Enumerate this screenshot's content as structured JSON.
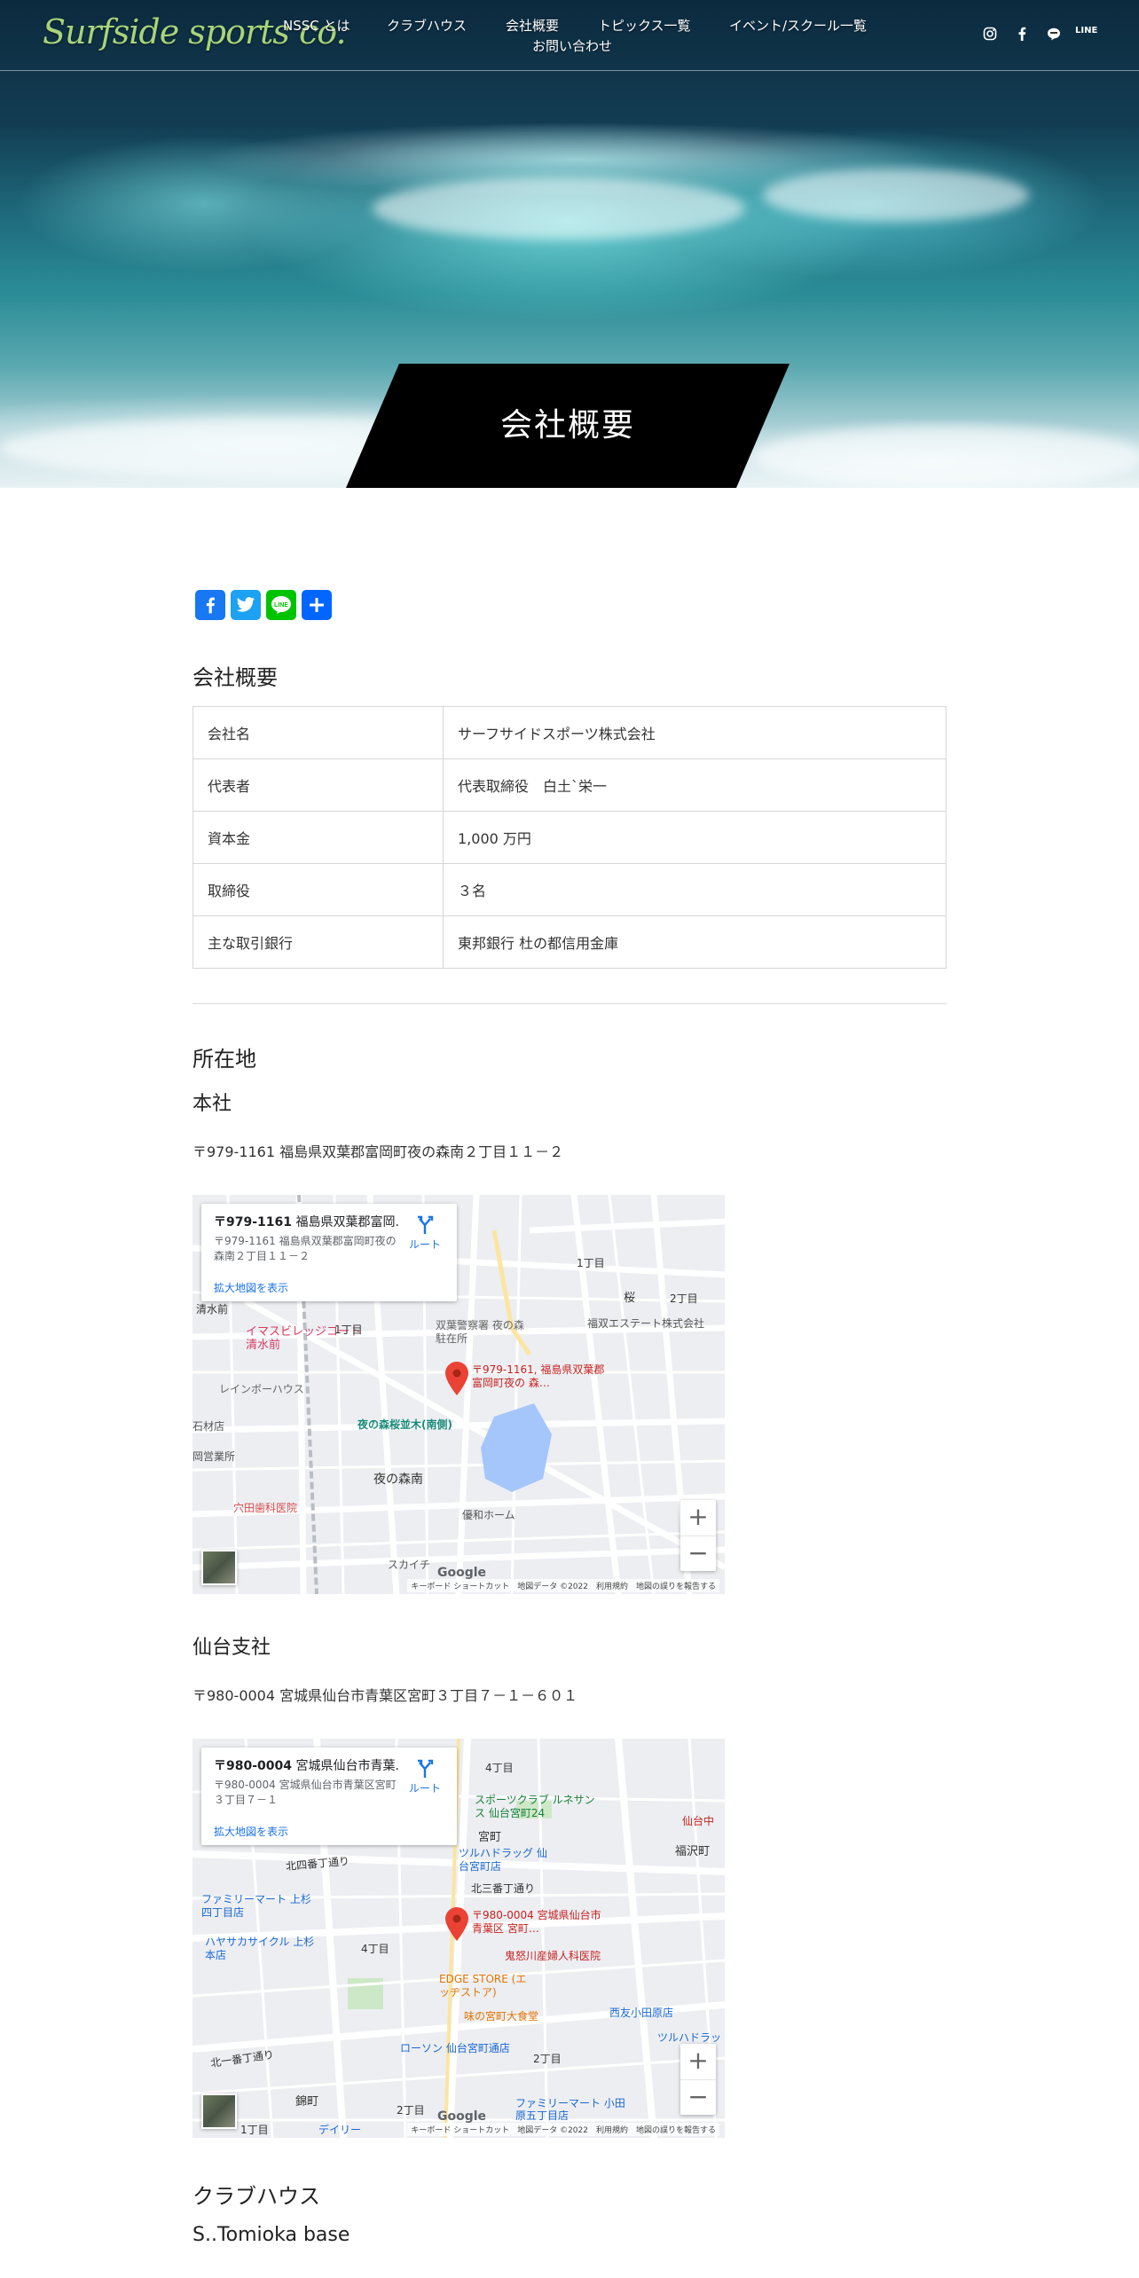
{
  "header": {
    "logo": "Surfside sports co.",
    "nav": [
      "NSSC とは",
      "クラブハウス",
      "会社概要",
      "トピックス一覧",
      "イベント/スクール一覧",
      "お問い合わせ"
    ],
    "sns_icons": [
      "instagram-icon",
      "facebook-icon",
      "line-icon",
      "line-official-icon"
    ],
    "line_badge": "LINE"
  },
  "hero": {
    "title": "会社概要"
  },
  "share": [
    "facebook-share-icon",
    "twitter-share-icon",
    "line-share-icon",
    "share-icon"
  ],
  "company": {
    "heading": "会社概要",
    "rows": [
      {
        "key": "会社名",
        "value": "サーフサイドスポーツ株式会社"
      },
      {
        "key": "代表者",
        "value": "代表取締役　白土`栄一"
      },
      {
        "key": "資本金",
        "value": "1,000 万円"
      },
      {
        "key": "取締役",
        "value": "３名"
      },
      {
        "key": "主な取引銀行",
        "value": "東邦銀行 杜の都信用金庫"
      }
    ]
  },
  "locations": {
    "heading": "所在地",
    "honsha": {
      "title": "本社",
      "address": "〒979-1161 福島県双葉郡富岡町夜の森南２丁目１１－２",
      "map": {
        "card_title_bold": "〒979-1161",
        "card_title_rest": " 福島県双葉郡富岡...",
        "card_address": "〒979-1161 福島県双葉郡富岡町夜の森南２丁目１１－２",
        "card_link": "拡大地図を表示",
        "route": "ルート",
        "pin_label": "〒979-1161, 福島県双葉郡富岡町夜の 森…",
        "labels": [
          "1丁目",
          "桜",
          "2丁目",
          "清水前",
          "イマスビレッジコート清水前",
          "1丁目",
          "双葉警察署 夜の森駐在所",
          "福双エステート株式会社",
          "レインボーハウス",
          "夜の森桜並木(南側)",
          "石材店",
          "岡営業所",
          "夜の森南",
          "穴田歯科医院",
          "優和ホーム",
          "スカイチ"
        ],
        "attribution": "キーボード ショートカット　地図データ ©2022　利用規約　地図の誤りを報告する",
        "google": "Google"
      }
    },
    "sendai": {
      "title": "仙台支社",
      "address": "〒980-0004 宮城県仙台市青葉区宮町３丁目７－１－６０１",
      "map": {
        "card_title_bold": "〒980-0004",
        "card_title_rest": " 宮城県仙台市青葉...",
        "card_address": "〒980-0004 宮城県仙台市青葉区宮町３丁目７－１",
        "card_link": "拡大地図を表示",
        "route": "ルート",
        "pin_label": "〒980-0004 宮城県仙台市青葉区 宮町…",
        "labels": [
          "4丁目",
          "スポーツクラブ ルネサンス 仙台宮町24",
          "仙台中",
          "北四番丁通り",
          "ツルハドラッグ 仙台宮町店",
          "福沢町",
          "宮町",
          "北三番丁通り",
          "ファミリーマート 上杉四丁目店",
          "ハヤサカサイクル 上杉本店",
          "4丁目",
          "鬼怒川産婦人科医院",
          "EDGE STORE (エッヂストア)",
          "味の宮町大食堂",
          "西友小田原店",
          "ツルハドラッ",
          "北一番丁通り",
          "ローソン 仙台宮町通店",
          "2丁目",
          "錦町",
          "2丁目",
          "ファミリーマート 小田原五丁目店",
          "1丁目",
          "デイリー"
        ],
        "attribution": "キーボード ショートカット　地図データ ©2022　利用規約　地図の誤りを報告する",
        "google": "Google"
      }
    },
    "clubhouse": {
      "title": "クラブハウス",
      "subtitle": "S..Tomioka base"
    }
  },
  "colors": {
    "accent_green": "#a8d47a",
    "banner_black": "#000000",
    "link_blue": "#1a73e8",
    "pin_red": "#ea4335"
  }
}
